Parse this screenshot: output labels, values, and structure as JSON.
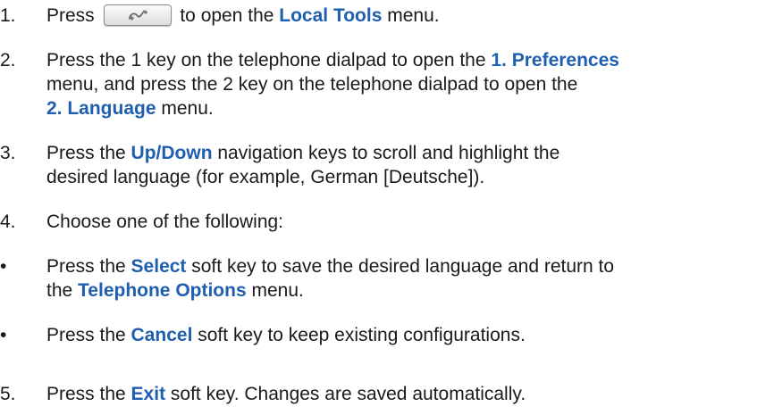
{
  "steps": [
    {
      "number": "1.",
      "lines": [
        {
          "segments": [
            {
              "t": "Press "
            },
            {
              "icon": "handset-options-key"
            },
            {
              "t": " to open the "
            },
            {
              "t": "Local Tools",
              "kw": true
            },
            {
              "t": " menu."
            }
          ]
        }
      ]
    },
    {
      "number": "2.",
      "lines": [
        {
          "segments": [
            {
              "t": "Press the 1 key on the telephone dialpad to open the "
            },
            {
              "t": "1. Preferences",
              "kw": true
            }
          ]
        },
        {
          "segments": [
            {
              "t": "menu, and press the 2 key on the telephone dialpad to open the"
            }
          ]
        },
        {
          "segments": [
            {
              "t": "2. Language",
              "kw": true
            },
            {
              "t": " menu."
            }
          ]
        }
      ]
    },
    {
      "number": "3.",
      "lines": [
        {
          "segments": [
            {
              "t": "Press the "
            },
            {
              "t": "Up/Down",
              "kw": true
            },
            {
              "t": " navigation keys to scroll and highlight the"
            }
          ]
        },
        {
          "segments": [
            {
              "t": "desired language (for example, German [Deutsche])."
            }
          ]
        }
      ]
    },
    {
      "number": "4.",
      "lines": [
        {
          "segments": [
            {
              "t": "Choose one of the following:"
            }
          ]
        }
      ]
    },
    {
      "number": "•",
      "lines": [
        {
          "segments": [
            {
              "t": "Press the "
            },
            {
              "t": "Select",
              "kw": true
            },
            {
              "t": " soft key to save the desired language and return to"
            }
          ]
        },
        {
          "segments": [
            {
              "t": "the "
            },
            {
              "t": "Telephone Options",
              "kw": true
            },
            {
              "t": " menu."
            }
          ]
        }
      ]
    },
    {
      "number": "•",
      "lines": [
        {
          "segments": [
            {
              "t": "Press the "
            },
            {
              "t": "Cancel",
              "kw": true
            },
            {
              "t": " soft key to keep existing configurations."
            }
          ]
        }
      ]
    },
    {
      "number": "5.",
      "lines": [
        {
          "segments": [
            {
              "t": "Press the "
            },
            {
              "t": "Exit",
              "kw": true
            },
            {
              "t": " soft key. Changes are saved automatically."
            }
          ]
        }
      ]
    }
  ],
  "colors": {
    "keyword": "#1f5fb0",
    "body_text": "#1a1a1a"
  }
}
